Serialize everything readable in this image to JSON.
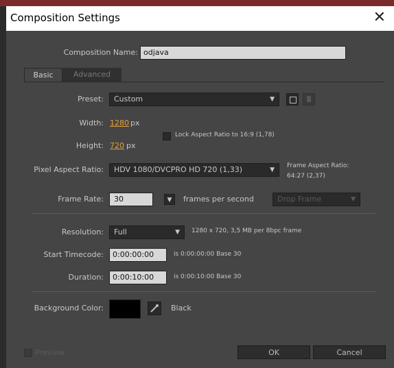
{
  "window": {
    "title": "Composition Settings",
    "close_icon": "close-icon"
  },
  "comp_name": {
    "label": "Composition Name:",
    "value": "odjava"
  },
  "tabs": [
    {
      "label": "Basic",
      "active": true
    },
    {
      "label": "Advanced",
      "active": false
    }
  ],
  "preset": {
    "label": "Preset:",
    "value": "Custom"
  },
  "width": {
    "label": "Width:",
    "value": "1280",
    "unit": "px"
  },
  "height": {
    "label": "Height:",
    "value": "720",
    "unit": "px"
  },
  "lock_aspect": {
    "label": "Lock Aspect Ratio to 16:9 (1,78)",
    "checked": false
  },
  "pixel_aspect": {
    "label": "Pixel Aspect Ratio:",
    "value": "HDV 1080/DVCPRO HD 720 (1,33)"
  },
  "frame_aspect": {
    "label": "Frame Aspect Ratio:",
    "value": "64:27 (2,37)"
  },
  "frame_rate": {
    "label": "Frame Rate:",
    "value": "30",
    "unit": "frames per second",
    "drop_frame": "Drop Frame"
  },
  "resolution": {
    "label": "Resolution:",
    "value": "Full",
    "info": "1280 x 720, 3,5 MB per 8bpc frame"
  },
  "start_timecode": {
    "label": "Start Timecode:",
    "value": "0:00:00:00",
    "info": "is 0:00:00:00  Base 30"
  },
  "duration": {
    "label": "Duration:",
    "value": "0:00:10:00",
    "info": "is 0:00:10:00  Base 30"
  },
  "background": {
    "label": "Background Color:",
    "color": "#000000",
    "name": "Black"
  },
  "footer": {
    "preview_label": "Preview",
    "ok_label": "OK",
    "cancel_label": "Cancel"
  },
  "colors": {
    "accent": "#e2a23a",
    "panel": "#454545"
  }
}
